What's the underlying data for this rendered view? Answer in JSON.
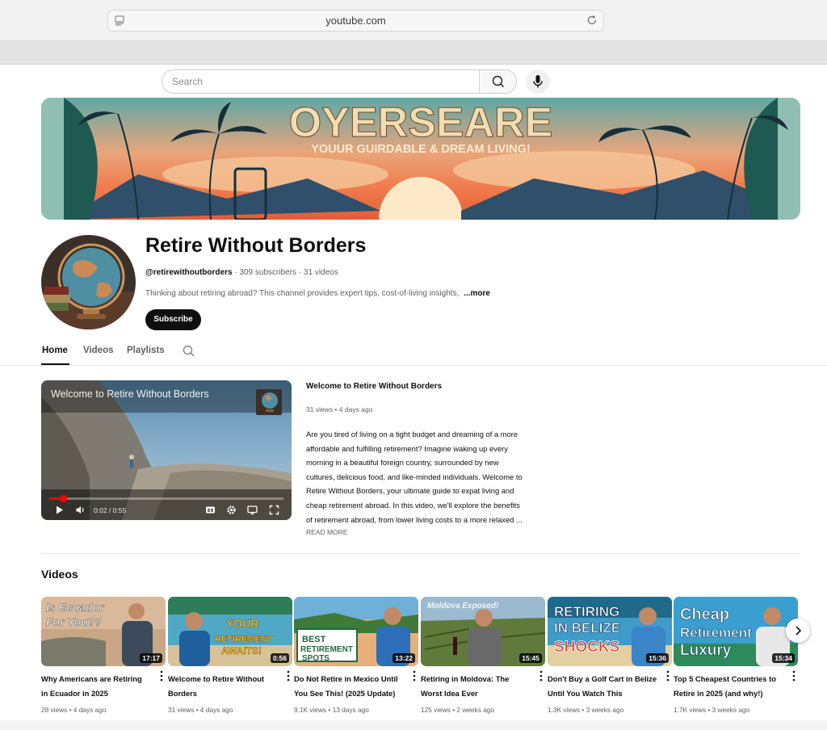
{
  "browser": {
    "url": "youtube.com"
  },
  "search": {
    "placeholder": "Search"
  },
  "banner": {
    "headline": "OYERSEARE",
    "tagline": "YOUUR GUIRDABLE & DREAM LIVING!"
  },
  "channel": {
    "name": "Retire Without Borders",
    "handle": "@retirewithoutborders",
    "subscribers": "309 subscribers",
    "video_count": "31 videos",
    "meta_separator": " · ",
    "description": "Thinking about retiring abroad? This channel provides expert tips, cost-of-living insights, ",
    "more_label": "...more",
    "subscribe_label": "Subscribe"
  },
  "tabs": [
    {
      "label": "Home",
      "active": true
    },
    {
      "label": "Videos",
      "active": false
    },
    {
      "label": "Playlists",
      "active": false
    }
  ],
  "featured": {
    "player_title": "Welcome to Retire Without Borders",
    "time": "0:02 / 0:55",
    "progress": 0.06,
    "title": "Welcome to Retire Without Borders",
    "meta": "31 views • 4 days ago",
    "description_lines": [
      "Are you tired of living on a tight budget and dreaming of a more",
      "affordable and fulfilling retirement? Imagine waking up every",
      "morning in a beautiful foreign country, surrounded by new",
      "cultures, delicious food, and like-minded individuals. Welcome to",
      "Retire Without Borders, your ultimate guide to expat living and",
      "cheap retirement abroad. In this video, we'll explore the benefits",
      "of retirement abroad, from lower living costs to a more relaxed ..."
    ],
    "read_more": "READ MORE"
  },
  "videos_section": {
    "heading": "Videos",
    "items": [
      {
        "thumb_text": "Is Ecuador For You??",
        "duration": "17:17",
        "title_lines": [
          "Why Americans are Retiring",
          "in Ecuador in 2025"
        ],
        "meta": "28 views • 4 days ago"
      },
      {
        "thumb_text": "YOUR RETIREMENT AWAITS!",
        "duration": "0:56",
        "title_lines": [
          "Welcome to Retire Without",
          "Borders"
        ],
        "meta": "31 views • 4 days ago"
      },
      {
        "thumb_text": "BEST RETIREMENT SPOTS",
        "duration": "13:22",
        "title_lines": [
          "Do Not Retire in Mexico Until",
          "You See This! (2025 Update)"
        ],
        "meta": "9.1K views • 13 days ago"
      },
      {
        "thumb_text": "Moldova Exposed!",
        "duration": "15:45",
        "title_lines": [
          "Retiring in Moldova: The",
          "Worst Idea Ever"
        ],
        "meta": "125 views • 2 weeks ago"
      },
      {
        "thumb_text": "RETIRING IN BELIZE SHOCKS",
        "duration": "15:36",
        "title_lines": [
          "Don't Buy a Golf Cart in Belize",
          "Until You Watch This"
        ],
        "meta": "1.3K views • 3 weeks ago"
      },
      {
        "thumb_text": "Cheap Retirement Luxury",
        "duration": "15:34",
        "title_lines": [
          "Top 5 Cheapest Countries to",
          "Retire in 2025 (and why!)"
        ],
        "meta": "1.7K views • 3 weeks ago"
      }
    ]
  },
  "icons": {
    "url_left": "page-icon",
    "reload": "reload-icon",
    "search": "search-icon",
    "mic": "microphone-icon",
    "next": "chevron-right-icon",
    "menu": "more-vert-icon"
  },
  "colors": {
    "subscribe_bg": "#0f0f0f",
    "progress": "#ff0000",
    "text_secondary": "#606060"
  }
}
